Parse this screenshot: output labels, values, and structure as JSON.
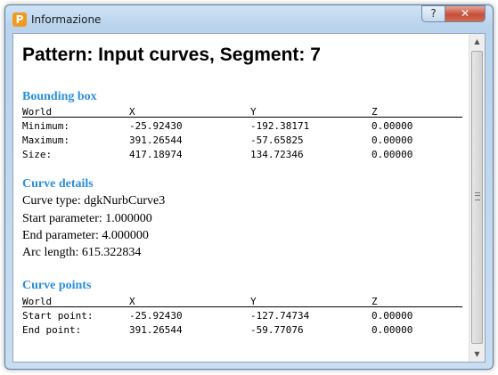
{
  "window": {
    "title": "Informazione",
    "icon_letter": "P",
    "help_glyph": "?",
    "close_glyph": "✕"
  },
  "heading": "Pattern: Input curves, Segment: 7",
  "bounding_box": {
    "title": "Bounding box",
    "headers": [
      "World",
      "X",
      "Y",
      "Z"
    ],
    "rows": [
      [
        "Minimum:",
        "-25.92430",
        "-192.38171",
        "0.00000"
      ],
      [
        "Maximum:",
        "391.26544",
        "-57.65825",
        "0.00000"
      ],
      [
        "Size:",
        "417.18974",
        "134.72346",
        "0.00000"
      ]
    ]
  },
  "curve_details": {
    "title": "Curve details",
    "lines": [
      "Curve type: dgkNurbCurve3",
      "Start parameter: 1.000000",
      "End parameter: 4.000000",
      "Arc length: 615.322834"
    ]
  },
  "curve_points": {
    "title": "Curve points",
    "headers": [
      "World",
      "X",
      "Y",
      "Z"
    ],
    "rows": [
      [
        "Start point:",
        "-25.92430",
        "-127.74734",
        "0.00000"
      ],
      [
        "End point:",
        "391.26544",
        "-59.77076",
        "0.00000"
      ]
    ]
  },
  "scrollbar": {
    "up_glyph": "▲",
    "down_glyph": "▼"
  }
}
